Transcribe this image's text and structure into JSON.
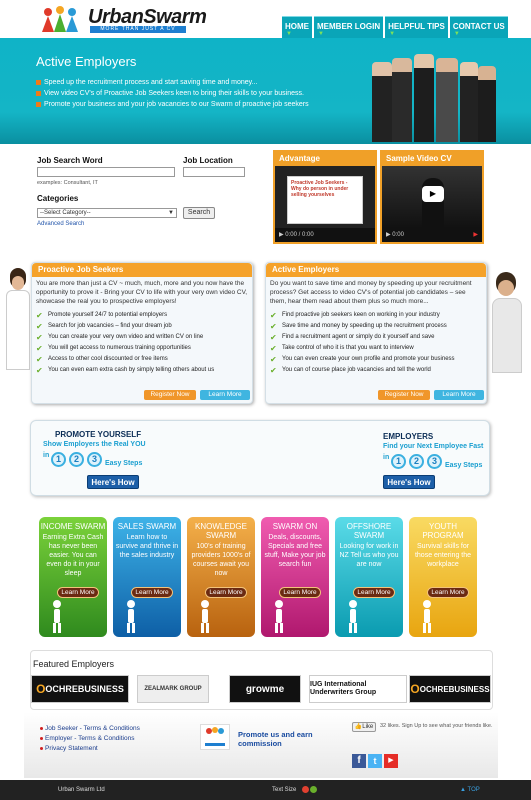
{
  "header": {
    "logo_text": "UrbanSwarm",
    "tagline": "MORE THAN JUST A CV"
  },
  "nav": [
    "HOME",
    "MEMBER LOGIN",
    "HELPFUL TIPS",
    "CONTACT US"
  ],
  "banner": {
    "title": "Active Employers",
    "bullets": [
      "Speed up the recruitment process and start saving time and money...",
      "View video CV's of Proactive Job Seekers keen to bring their skills to your business.",
      "Promote your business and your job vacancies to our Swarm of proactive job seekers"
    ]
  },
  "search": {
    "keyword_label": "Job Search Word",
    "location_label": "Job Location",
    "examples": "examples: Consultant, IT",
    "categories_label": "Categories",
    "select_value": "--Select Category--",
    "search_btn": "Search",
    "advanced": "Advanced Search"
  },
  "videos": [
    {
      "title": "Advantage",
      "slide_title": "Proactive Job Seekers - Why do person in under selling yourselves",
      "time": "0:00 / 0:00"
    },
    {
      "title": "Sample Video CV",
      "time": "0:00"
    }
  ],
  "panels": {
    "seekers": {
      "title": "Proactive Job Seekers",
      "desc": "You are more than just a CV ~ much, much, more and you now have the opportunity to prove it - Bring your CV to life with your very own video CV, showcase the real you to prospective employers!",
      "items": [
        "Promote yourself 24/7 to potential employers",
        "Search for job vacancies – find your dream job",
        "You can create your very own video and written CV on line",
        "You will get access to numerous training opportunities",
        "Access to other cool discounted or free items",
        "You can even earn extra cash by simply telling others about us"
      ],
      "register": "Register Now",
      "learn": "Learn More"
    },
    "employers": {
      "title": "Active Employers",
      "desc": "Do you want to save time and money by speeding up your recruitment process? Get access to video CV's of potential job candidates – see them, hear them read about them plus so much more...",
      "items": [
        "Find proactive job seekers keen on working in your industry",
        "Save time and money by speeding up the recruitment process",
        "Find a recruitment agent or simply do it yourself and save",
        "Take control of who it is that you want to interview",
        "You can even create your own profile and promote your business",
        "You can of course place job vacancies and tell the world"
      ],
      "register": "Register Now",
      "learn": "Learn More"
    }
  },
  "steps": {
    "left_title": "PROMOTE YOURSELF",
    "left_sub": "Show Employers the Real YOU",
    "right_title": "EMPLOYERS",
    "right_sub": "Find your Next Employee Fast",
    "in": "in",
    "easy": "Easy Steps",
    "nums": [
      "1",
      "2",
      "3"
    ],
    "how": "Here's How"
  },
  "cards": [
    {
      "title": "INCOME SWARM",
      "body": "Earning Extra Cash has never been easier. You can even do it in your sleep",
      "color": "#2f8a1e",
      "color2": "#7bd23a",
      "learn": "Learn More"
    },
    {
      "title": "SALES SWARM",
      "body": "Learn how to survive and thrive in the sales industry",
      "color": "#0e5fa6",
      "color2": "#3eb3e8",
      "learn": "Learn More"
    },
    {
      "title": "KNOWLEDGE SWARM",
      "body": "100's of training providers 1000's of courses await you now",
      "color": "#b8620f",
      "color2": "#f4b04a",
      "learn": "Learn More"
    },
    {
      "title": "SWARM ON",
      "body": "Deals, discounts, Specials and free stuff, Make your job search fun",
      "color": "#b0186e",
      "color2": "#f05cb0",
      "learn": "Learn More"
    },
    {
      "title": "OFFSHORE SWARM",
      "body": "Looking for work in NZ Tell us who you are now",
      "color": "#0a9bb0",
      "color2": "#5adbe8",
      "learn": "Learn More"
    },
    {
      "title": "YOUTH PROGRAM",
      "body": "Survival skills for those entering the workplace",
      "color": "#e8a510",
      "color2": "#f9da62",
      "learn": "Learn More"
    }
  ],
  "featured": {
    "title": "Featured Employers",
    "logos": [
      "OCHREBUSINESS",
      "ZEALMARK GROUP",
      "growme",
      "IUG International Underwriters Group",
      "OCHREBUSINESS"
    ]
  },
  "footer": {
    "links": [
      "Job Seeker - Terms & Conditions",
      "Employer - Terms & Conditions",
      "Privacy Statement"
    ],
    "promote": "Promote us and earn commission",
    "like": "Like",
    "likes_text": "32 likes. Sign Up to see what your friends like.",
    "company": "Urban Swarm Ltd",
    "text_size": "Text Size",
    "top": "TOP"
  }
}
